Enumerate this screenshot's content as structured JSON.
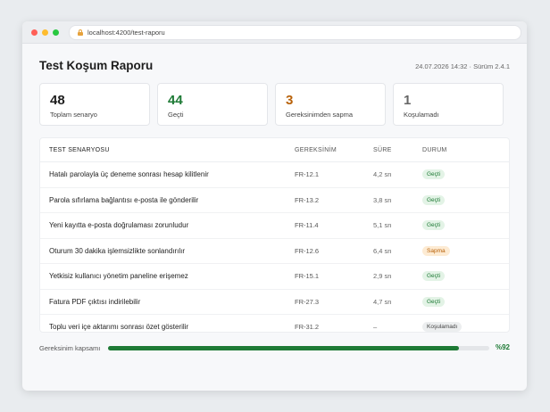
{
  "browser": {
    "url": "localhost:4200/test-raporu",
    "dot_colors": [
      "#ff5f57",
      "#febc2e",
      "#28c840"
    ]
  },
  "header": {
    "title": "Test Koşum Raporu",
    "meta": "24.07.2026 14:32 · Sürüm 2.4.1"
  },
  "stats": [
    {
      "value": "48",
      "label": "Toplam senaryo",
      "color": "#1e1e1e"
    },
    {
      "value": "44",
      "label": "Geçti",
      "color": "#1e7a35"
    },
    {
      "value": "3",
      "label": "Gereksinimden sapma",
      "color": "#b8620a"
    },
    {
      "value": "1",
      "label": "Koşulamadı",
      "color": "#666666"
    }
  ],
  "table": {
    "headers": {
      "scenario": "TEST SENARYOSU",
      "requirement": "GEREKSİNİM",
      "duration": "SÜRE",
      "status": "DURUM"
    },
    "rows": [
      {
        "scenario": "Hatalı parolayla üç deneme sonrası hesap kilitlenir",
        "requirement": "FR-12.1",
        "duration": "4,2 sn",
        "status": "Geçti",
        "status_type": "pass"
      },
      {
        "scenario": "Parola sıfırlama bağlantısı e-posta ile gönderilir",
        "requirement": "FR-13.2",
        "duration": "3,8 sn",
        "status": "Geçti",
        "status_type": "pass"
      },
      {
        "scenario": "Yeni kayıtta e-posta doğrulaması zorunludur",
        "requirement": "FR-11.4",
        "duration": "5,1 sn",
        "status": "Geçti",
        "status_type": "pass"
      },
      {
        "scenario": "Oturum 30 dakika işlemsizlikte sonlandırılır",
        "requirement": "FR-12.6",
        "duration": "6,4 sn",
        "status": "Sapma",
        "status_type": "dev"
      },
      {
        "scenario": "Yetkisiz kullanıcı yönetim paneline erişemez",
        "requirement": "FR-15.1",
        "duration": "2,9 sn",
        "status": "Geçti",
        "status_type": "pass"
      },
      {
        "scenario": "Fatura PDF çıktısı indirilebilir",
        "requirement": "FR-27.3",
        "duration": "4,7 sn",
        "status": "Geçti",
        "status_type": "pass"
      },
      {
        "scenario": "Toplu veri içe aktarımı sonrası özet gösterilir",
        "requirement": "FR-31.2",
        "duration": "–",
        "status": "Koşulamadı",
        "status_type": "skip"
      }
    ]
  },
  "coverage": {
    "label": "Gereksinim kapsamı",
    "value_text": "%92",
    "fraction": 0.92
  }
}
